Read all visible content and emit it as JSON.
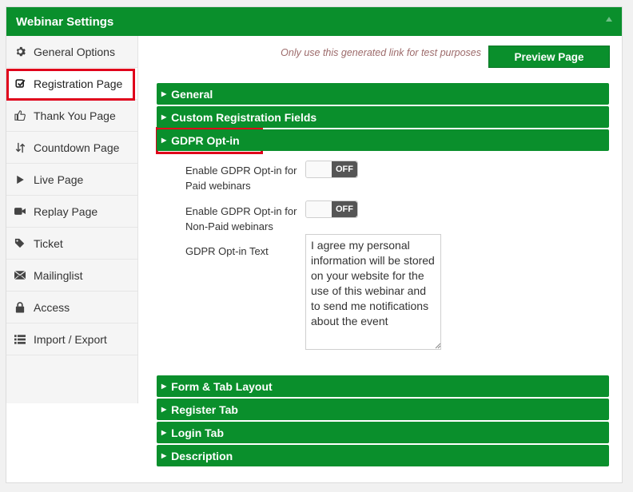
{
  "header": {
    "title": "Webinar Settings"
  },
  "sidebar": {
    "items": [
      {
        "label": "General Options",
        "icon": "gear-icon"
      },
      {
        "label": "Registration Page",
        "icon": "check-square-icon"
      },
      {
        "label": "Thank You Page",
        "icon": "thumbs-up-icon"
      },
      {
        "label": "Countdown Page",
        "icon": "sort-arrows-icon"
      },
      {
        "label": "Live Page",
        "icon": "play-icon"
      },
      {
        "label": "Replay Page",
        "icon": "video-camera-icon"
      },
      {
        "label": "Ticket",
        "icon": "tags-icon"
      },
      {
        "label": "Mailinglist",
        "icon": "envelope-icon"
      },
      {
        "label": "Access",
        "icon": "lock-icon"
      },
      {
        "label": "Import / Export",
        "icon": "list-icon"
      }
    ],
    "active": "Registration Page"
  },
  "main": {
    "note": "Only use this generated link for test purposes",
    "preview_label": "Preview Page",
    "sections_top": [
      "General",
      "Custom Registration Fields",
      "GDPR Opt-in"
    ],
    "gdpr": {
      "paid_label": "Enable GDPR Opt-in for Paid webinars",
      "paid_state": "OFF",
      "nonpaid_label": "Enable GDPR Opt-in for Non-Paid webinars",
      "nonpaid_state": "OFF",
      "text_label": "GDPR Opt-in Text",
      "text_value": "I agree my personal information will be stored on your website for the use of this webinar and to send me notifications about the event"
    },
    "sections_bottom": [
      "Form & Tab Layout",
      "Register Tab",
      "Login Tab",
      "Description"
    ]
  },
  "colors": {
    "accent": "#0a8f2c",
    "highlight": "#e0001b",
    "note": "#9d6b6b"
  }
}
